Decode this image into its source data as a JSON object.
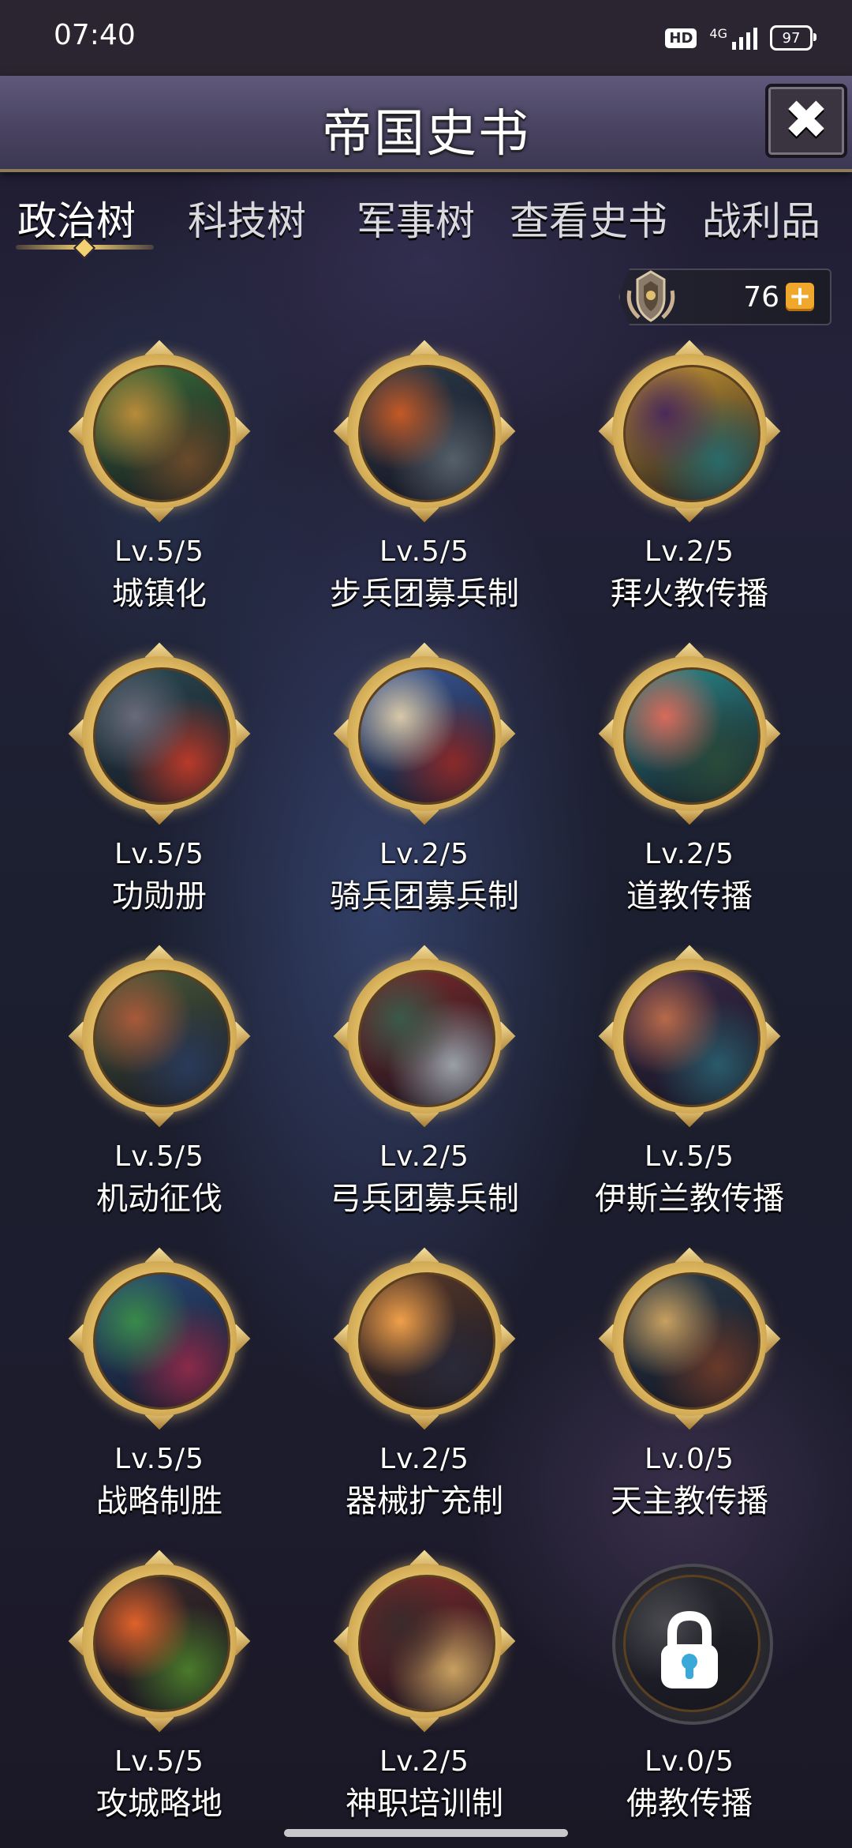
{
  "status_bar": {
    "time": "07:40",
    "hd_badge": "HD",
    "network": "4G",
    "battery": "97"
  },
  "header": {
    "title": "帝国史书",
    "close_icon": "close-icon"
  },
  "tabs": [
    {
      "label": "政治树",
      "active": true
    },
    {
      "label": "科技树",
      "active": false
    },
    {
      "label": "军事树",
      "active": false
    },
    {
      "label": "查看史书",
      "active": false
    },
    {
      "label": "战利品",
      "active": false
    }
  ],
  "currency": {
    "icon": "laurel-emblem-icon",
    "value": "76",
    "plus_icon": "plus-icon"
  },
  "nodes": [
    {
      "level": "Lv.5/5",
      "name": "城镇化",
      "locked": false,
      "palette": [
        "#3b6d3a",
        "#b98b3a",
        "#6a4a2a"
      ]
    },
    {
      "level": "Lv.5/5",
      "name": "步兵团募兵制",
      "locked": false,
      "palette": [
        "#2b3a4a",
        "#c45a26",
        "#55606a"
      ]
    },
    {
      "level": "Lv.2/5",
      "name": "拜火教传播",
      "locked": false,
      "palette": [
        "#c89630",
        "#4a2a5a",
        "#2a6a6a"
      ]
    },
    {
      "level": "Lv.5/5",
      "name": "功勋册",
      "locked": false,
      "palette": [
        "#2a4a52",
        "#6a6a7a",
        "#b83a2a"
      ]
    },
    {
      "level": "Lv.2/5",
      "name": "骑兵团募兵制",
      "locked": false,
      "palette": [
        "#3a5a9a",
        "#d8c8a8",
        "#8a2a2a"
      ]
    },
    {
      "level": "Lv.2/5",
      "name": "道教传播",
      "locked": false,
      "palette": [
        "#2a8a8a",
        "#d86a5a",
        "#2a4a3a"
      ]
    },
    {
      "level": "Lv.5/5",
      "name": "机动征伐",
      "locked": false,
      "palette": [
        "#4a5a3a",
        "#a85a3a",
        "#2a3a5a"
      ]
    },
    {
      "level": "Lv.2/5",
      "name": "弓兵团募兵制",
      "locked": false,
      "palette": [
        "#7a2a2a",
        "#3a5a4a",
        "#9aa0a8"
      ]
    },
    {
      "level": "Lv.5/5",
      "name": "伊斯兰教传播",
      "locked": false,
      "palette": [
        "#3a2a4a",
        "#b86a4a",
        "#2a5a6a"
      ]
    },
    {
      "level": "Lv.5/5",
      "name": "战略制胜",
      "locked": false,
      "palette": [
        "#2a4a7a",
        "#3a8a4a",
        "#8a2a4a"
      ]
    },
    {
      "level": "Lv.2/5",
      "name": "器械扩充制",
      "locked": false,
      "palette": [
        "#5a3a2a",
        "#f0a04a",
        "#2a2a3a"
      ]
    },
    {
      "level": "Lv.0/5",
      "name": "天主教传播",
      "locked": false,
      "palette": [
        "#2a3a4a",
        "#c8a060",
        "#6a3a2a"
      ]
    },
    {
      "level": "Lv.5/5",
      "name": "攻城略地",
      "locked": false,
      "palette": [
        "#3a2a2a",
        "#e0622a",
        "#4a7a2a"
      ]
    },
    {
      "level": "Lv.2/5",
      "name": "神职培训制",
      "locked": false,
      "palette": [
        "#7a2a2a",
        "#3a2a2a",
        "#c8a060"
      ]
    },
    {
      "level": "Lv.0/5",
      "name": "佛教传播",
      "locked": true,
      "palette": [
        "#2a2a30",
        "#4a4a50",
        "#1a1a20"
      ]
    }
  ]
}
